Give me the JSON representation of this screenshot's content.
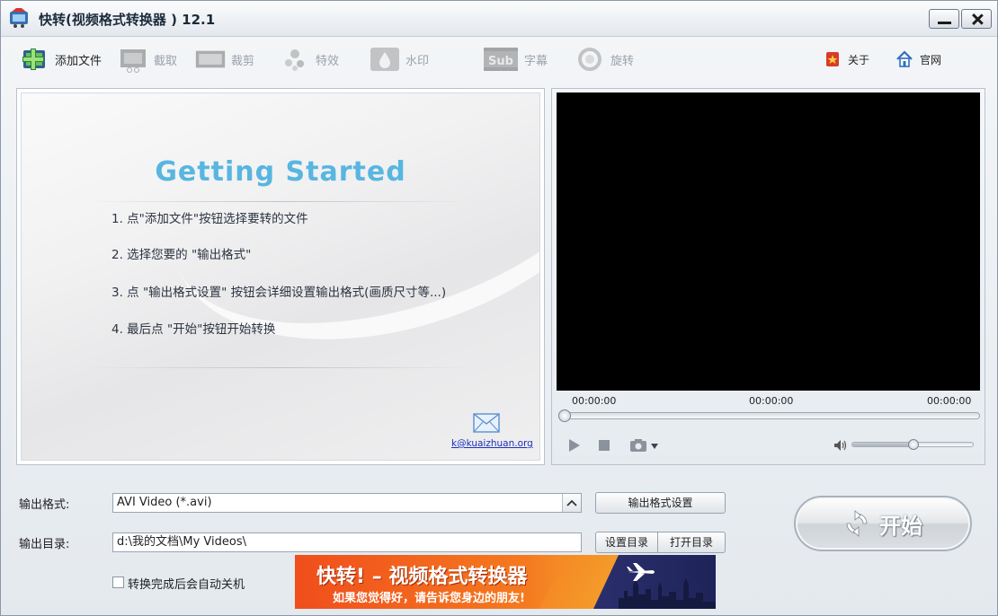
{
  "window": {
    "title": "快转(视频格式转换器 ) 12.1"
  },
  "toolbar": {
    "items": [
      {
        "label": "添加文件",
        "icon": "add-file-icon",
        "enabled": true
      },
      {
        "label": "截取",
        "icon": "film-clip-icon",
        "enabled": false
      },
      {
        "label": "裁剪",
        "icon": "crop-icon",
        "enabled": false
      },
      {
        "label": "特效",
        "icon": "effects-icon",
        "enabled": false
      },
      {
        "label": "水印",
        "icon": "watermark-icon",
        "enabled": false
      },
      {
        "label": "字幕",
        "icon": "subtitle-icon",
        "enabled": false
      },
      {
        "label": "旋转",
        "icon": "rotate-icon",
        "enabled": false
      }
    ],
    "about_label": "关于",
    "website_label": "官网"
  },
  "getting_started": {
    "title": "Getting Started",
    "steps": [
      "1. 点\"添加文件\"按钮选择要转的文件",
      "2. 选择您要的 \"输出格式\"",
      "3. 点 \"输出格式设置\" 按钮会详细设置输出格式(画质尺寸等...)",
      "4. 最后点 \"开始\"按钮开始转换"
    ],
    "email": "k@kuaizhuan.org"
  },
  "player": {
    "time_start": "00:00:00",
    "time_current": "00:00:00",
    "time_end": "00:00:00",
    "seek_fraction": 0.0,
    "volume_fraction": 0.5
  },
  "output": {
    "format_label": "输出格式:",
    "format_value": "AVI Video (*.avi)",
    "format_settings_button": "输出格式设置",
    "dir_label": "输出目录:",
    "dir_value": "d:\\我的文档\\My Videos\\",
    "set_dir_button": "设置目录",
    "open_dir_button": "打开目录",
    "shutdown_label": "转换完成后会自动关机",
    "shutdown_checked": false
  },
  "start_button": {
    "label": "开始"
  },
  "banner": {
    "headline": "快转! – 视频格式转换器",
    "tagline": "如果您觉得好，请告诉您身边的朋友!"
  }
}
